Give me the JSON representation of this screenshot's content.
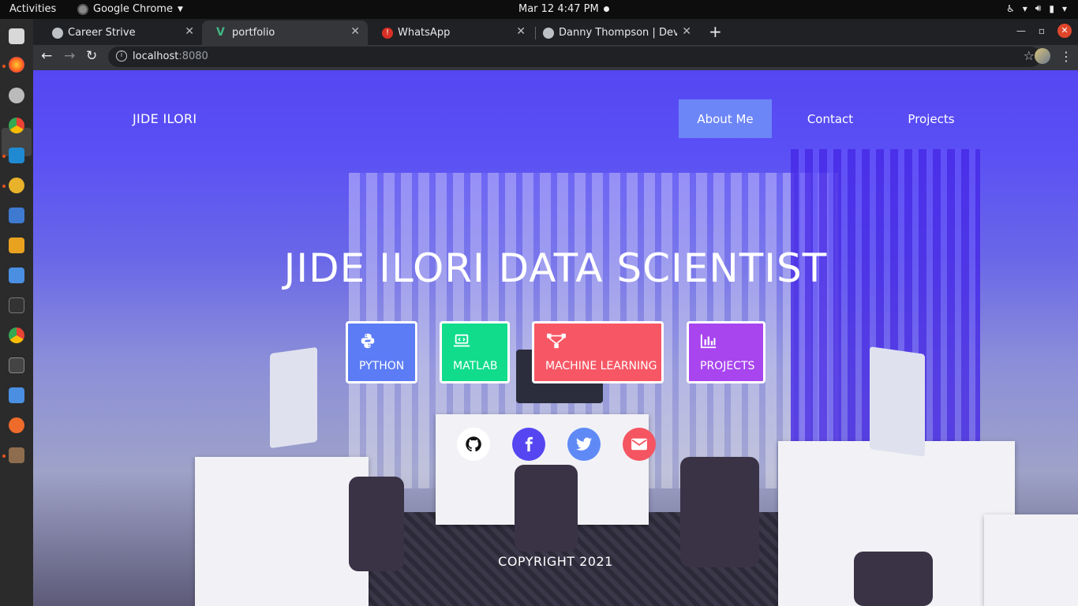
{
  "system_bar": {
    "activities": "Activities",
    "app_name": "Google Chrome",
    "clock": "Mar 12  4:47 PM"
  },
  "browser": {
    "tabs": [
      {
        "label": "Career Strive",
        "active": false
      },
      {
        "label": "portfolio",
        "active": true
      },
      {
        "label": "WhatsApp",
        "active": false
      },
      {
        "label": "Danny Thompson | Develo",
        "active": false
      }
    ],
    "new_tab": "+",
    "url_host": "localhost",
    "url_port": ":8080"
  },
  "site": {
    "brand": "JIDE ILORI",
    "nav": [
      {
        "label": "About Me",
        "active": true
      },
      {
        "label": "Contact",
        "active": false
      },
      {
        "label": "Projects",
        "active": false
      }
    ],
    "hero_title": "JIDE ILORI DATA SCIENTIST",
    "skills": [
      {
        "label": "PYTHON",
        "icon": "python-icon",
        "color": "#5b7cf5"
      },
      {
        "label": "MATLAB",
        "icon": "laptop-code-icon",
        "color": "#10dc8c"
      },
      {
        "label": "MACHINE LEARNING",
        "icon": "project-diagram-icon",
        "color": "#f75765"
      },
      {
        "label": "PROJECTS",
        "icon": "chart-bar-icon",
        "color": "#a845ee"
      }
    ],
    "social": [
      {
        "name": "github-icon",
        "bg": "#ffffff",
        "fg": "#111111"
      },
      {
        "name": "facebook-icon",
        "bg": "#5546f1",
        "fg": "#ffffff"
      },
      {
        "name": "twitter-icon",
        "bg": "#5f8af6",
        "fg": "#ffffff"
      },
      {
        "name": "envelope-icon",
        "bg": "#f45561",
        "fg": "#ffffff"
      }
    ],
    "copyright": "COPYRIGHT 2021"
  }
}
